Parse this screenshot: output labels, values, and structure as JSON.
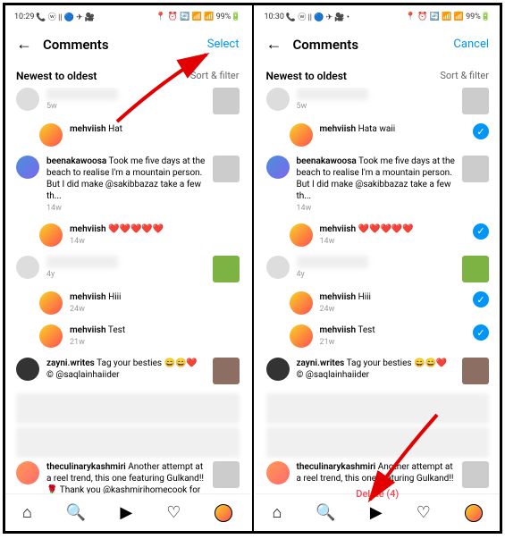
{
  "left": {
    "status_time": "10:29",
    "battery": "99%",
    "header": {
      "title": "Comments",
      "action": "Select"
    },
    "sort_label": "Newest to oldest",
    "sort_filter": "Sort & filter",
    "c1_time": "5w",
    "c2_user": "mehviish",
    "c2_text": "Hat",
    "c2_time": "",
    "c3_user": "beenakawoosa",
    "c3_text": "Took me five days at the beach to realise I'm a mountain person. But I did make @sakibbazaz take a few th...",
    "c3_time": "14w",
    "c4_user": "mehviish",
    "c4_text": "❤️❤️❤️❤️❤️",
    "c4_time": "14w",
    "c5_time": "4y",
    "c6_user": "mehviish",
    "c6_text": "Hiii",
    "c6_time": "24w",
    "c7_user": "mehviish",
    "c7_text": "Test",
    "c7_time": "21w",
    "c8_user": "zayni.writes",
    "c8_text": "Tag your besties 😄😄❤️ © @saqlainhaiider",
    "c9_user": "theculinarykashmiri",
    "c9_text": "Another attempt at a reel trend, this one featuring Gulkand!! 🌹 Thank you @kashmirihomecook for the rec..."
  },
  "right": {
    "status_time": "10:30",
    "battery": "99%",
    "header": {
      "title": "Comments",
      "action": "Cancel"
    },
    "sort_label": "Newest to oldest",
    "sort_filter": "Sort & filter",
    "c1_time": "5w",
    "c2_user": "mehviish",
    "c2_text": "Hata waii",
    "c3_user": "beenakawoosa",
    "c3_text": "Took me five days at the beach to realise I'm a mountain person. But I did make @sakibbazaz take a few th...",
    "c3_time": "14w",
    "c4_user": "mehviish",
    "c4_text": "❤️❤️❤️❤️❤️",
    "c4_time": "14w",
    "c5_time": "4y",
    "c6_user": "mehviish",
    "c6_text": "Hiii",
    "c6_time": "24w",
    "c7_user": "mehviish",
    "c7_text": "Test",
    "c7_time": "21w",
    "c8_user": "zayni.writes",
    "c8_text": "Tag your besties 😄😄❤️ © @saqlainhaiider",
    "c9_user": "theculinarykashmiri",
    "c9_text": "Another attempt at a reel trend, this one featuring Gulkand!!",
    "delete_label": "Delete (4)"
  }
}
